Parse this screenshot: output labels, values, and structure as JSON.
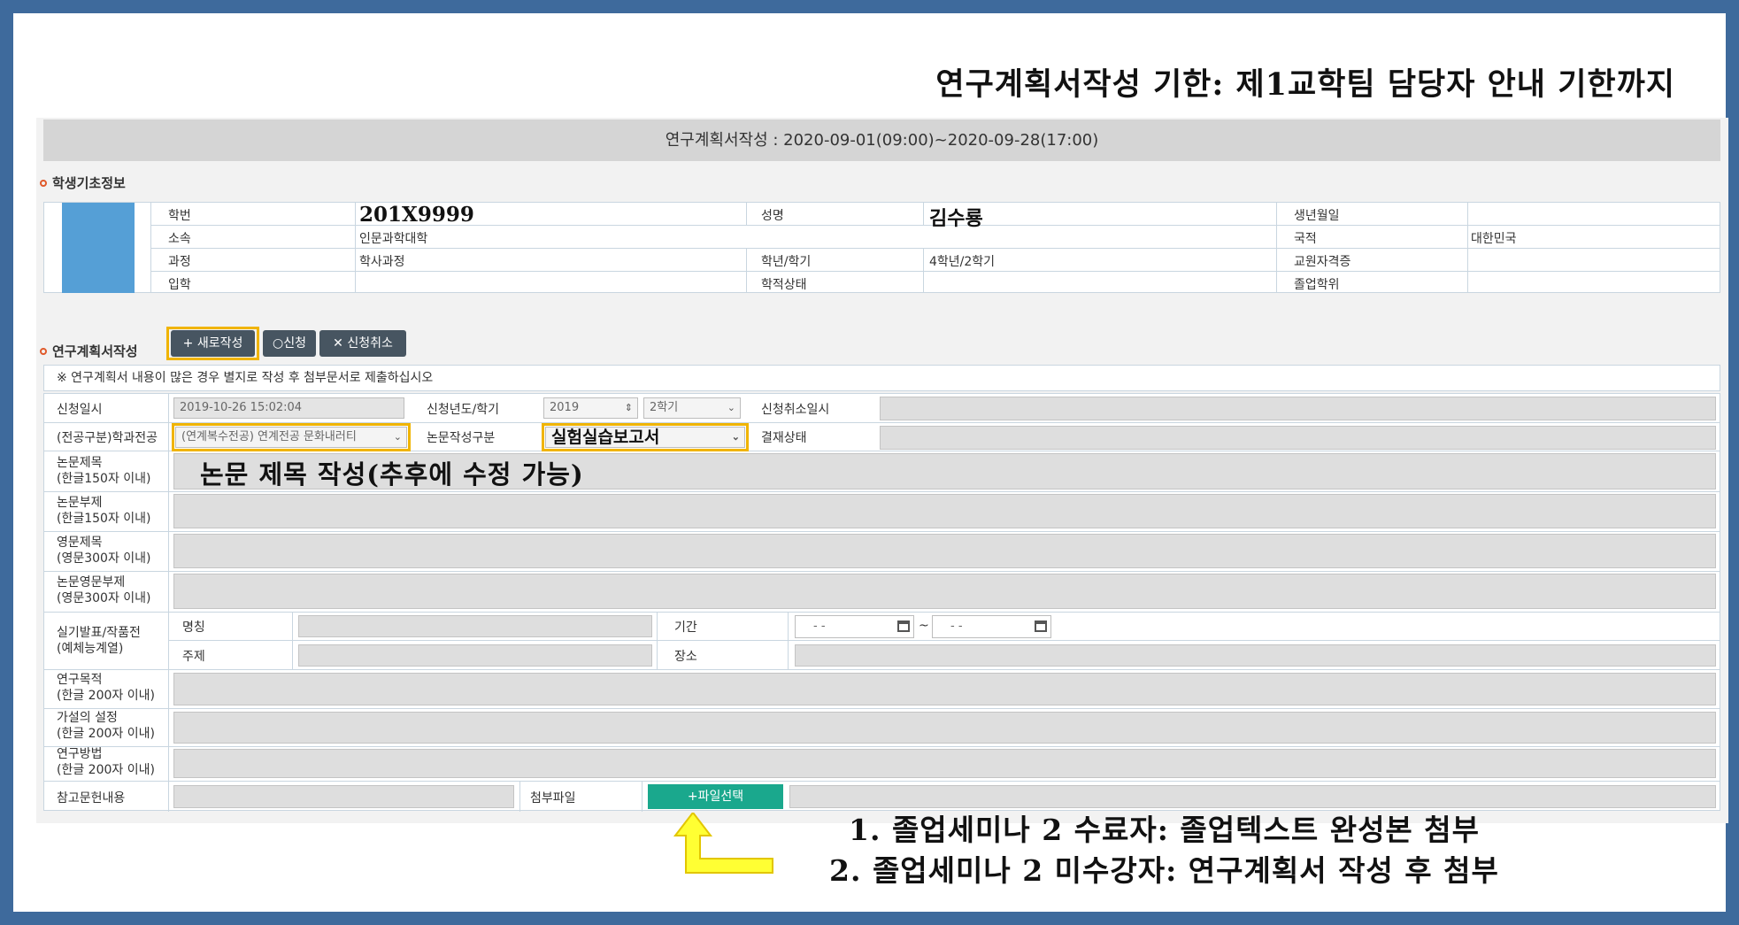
{
  "heading": "연구계획서작성 기한: 제1교학팀 담당자 안내 기한까지",
  "period_bar": "연구계획서작성 : 2020-09-01(09:00)~2020-09-28(17:00)",
  "student_section": {
    "title": "학생기초정보",
    "labels": {
      "student_id": "학번",
      "name": "성명",
      "birth": "생년월일",
      "affiliation": "소속",
      "nationality": "국적",
      "course": "과정",
      "year_term": "학년/학기",
      "teacher_cert": "교원자격증",
      "admission": "입학",
      "status": "학적상태",
      "degree": "졸업학위"
    },
    "values": {
      "student_id": "201X9999",
      "name": "김수룡",
      "birth": "",
      "affiliation": "인문과학대학",
      "nationality": "대한민국",
      "course": "학사과정",
      "year_term": "4학년/2학기",
      "teacher_cert": "",
      "admission": "",
      "status": "",
      "degree": ""
    }
  },
  "plan_section": {
    "title": "연구계획서작성",
    "buttons": {
      "new": "새로작성",
      "apply": "신청",
      "cancel": "신청취소"
    },
    "notice": "※ 연구계획서 내용이 많은 경우 별지로 작성 후 첨부문서로 제출하십시오",
    "labels": {
      "apply_date": "신청일시",
      "apply_year_term": "신청년도/학기",
      "cancel_date": "신청취소일시",
      "major": "(전공구분)학과전공",
      "thesis_type": "논문작성구분",
      "approval": "결재상태",
      "thesis_title": "논문제목\n(한글150자 이내)",
      "thesis_subtitle": "논문부제\n(한글150자 이내)",
      "eng_title": "영문제목\n(영문300자 이내)",
      "eng_subtitle": "논문영문부제\n(영문300자 이내)",
      "performance": "실기발표/작품전\n(예체능계열)",
      "perf_name": "명칭",
      "perf_period": "기간",
      "perf_topic": "주제",
      "perf_place": "장소",
      "purpose": "연구목적\n(한글 200자 이내)",
      "hypothesis": "가설의 설정\n(한글 200자 이내)",
      "method": "연구방법\n(한글 200자 이내)",
      "references": "참고문헌내용",
      "attachment": "첨부파일"
    },
    "values": {
      "apply_date": "2019-10-26 15:02:04",
      "year": "2019",
      "term": "2학기",
      "major": "(연계복수전공) 연계전공 문화내러티",
      "thesis_type": "실험실습보고서",
      "thesis_title_note": "논문 제목 작성(추후에 수정 가능)",
      "date_from": "- -",
      "date_sep": "~",
      "date_to": "- -",
      "file_button": "파일선택"
    }
  },
  "footnotes": [
    "1. 졸업세미나 2 수료자: 졸업텍스트 완성본 첨부",
    "2. 졸업세미나 2 미수강자: 연구계획서 작성 후 첨부"
  ],
  "colors": {
    "frame": "#3e6a9c",
    "highlight": "#f0b400",
    "teal": "#1aa88d",
    "photo": "#559fd6"
  }
}
